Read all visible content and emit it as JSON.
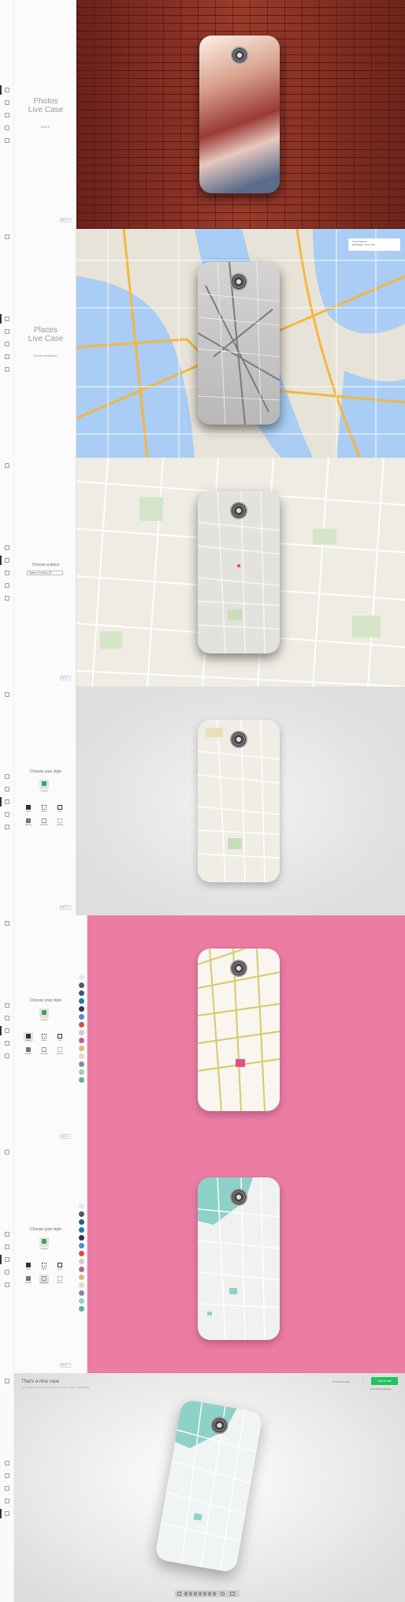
{
  "panels": [
    {
      "title_line1": "Photos",
      "title_line2": "Live Case",
      "link": "Shop it  ›",
      "next": "NEXT  ›"
    },
    {
      "title_line1": "Places",
      "title_line2": "Live Case",
      "link": "Choose destination  ›",
      "next": "NEXT  ›"
    },
    {
      "choose_place": "Choose a place",
      "select_value": "Statue of Liberty, NY",
      "next": "NEXT  ›"
    },
    {
      "choose_style": "Choose your style",
      "style_top": "Original",
      "styles": [
        "Atlas",
        "Metro",
        "Grid",
        "Pillows",
        "Rotated",
        "Outline"
      ],
      "next": "NEXT  ›"
    },
    {
      "choose_style": "Choose your style",
      "style_top": "Original",
      "styles": [
        "Atlas",
        "Metro",
        "Grid",
        "Pillows",
        "Rotated",
        "Outline"
      ],
      "next": "NEXT  ›"
    },
    {
      "choose_style": "Choose your style",
      "style_top": "Original",
      "styles": [
        "Atlas",
        "Metro",
        "Grid",
        "Pillows",
        "Rotated",
        "Outline"
      ],
      "next": "NEXT  ›"
    }
  ],
  "map_tooltip": {
    "title": "Times Square",
    "line": "Manhattan, New York"
  },
  "final": {
    "heading": "That's a nice case",
    "subtext": "Your design looks great. Add it to your cart or share it with friends.",
    "share": "Share this case",
    "add_button": "Add to cart",
    "price": "$ 34.95 free shipping"
  },
  "colors": {
    "brick": "#8a2e22",
    "pink": "#ec7ca4",
    "green": "#1ec45a",
    "accent": "#7b8fd6"
  },
  "swatch_colors": [
    "#e8e8e8",
    "#556",
    "#2a5c87",
    "#1f78b4",
    "#335",
    "#4a90c4",
    "#d94a3a",
    "#ccc",
    "#b68",
    "#d9b87a",
    "#e7d8c4",
    "#88a",
    "#9cb",
    "#6aa"
  ]
}
